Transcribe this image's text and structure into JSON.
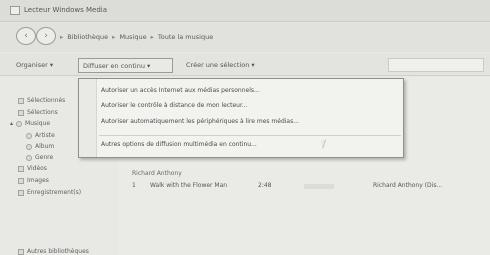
{
  "window": {
    "title": "Lecteur Windows Media"
  },
  "address": {
    "crumbs": [
      "Bibliothèque",
      "Musique",
      "Toute la musique"
    ]
  },
  "toolbar": {
    "organiser": "Organiser ▾",
    "diffuser": "Diffuser en continu ▾",
    "creer": "Créer une sélection ▾"
  },
  "sidebar": {
    "items": [
      "Sélectionnés",
      "Sélections",
      "Musique",
      "Artiste",
      "Album",
      "Genre",
      "Vidéos",
      "Images",
      "Enregistrement(s)",
      "Autres bibliothèques"
    ]
  },
  "menu": {
    "items": [
      "Autoriser un accès Internet aux médias personnels...",
      "Autoriser le contrôle à distance de mon lecteur...",
      "Autoriser automatiquement les périphériques à lire mes médias...",
      "Autres options de diffusion multimédia en continu..."
    ]
  },
  "content": {
    "group_artist": "Richard Anthony",
    "track": {
      "num": "1",
      "title": "Walk with the Flower Man",
      "duration": "2:48",
      "artist": "Richard Anthony (Dis..."
    }
  }
}
